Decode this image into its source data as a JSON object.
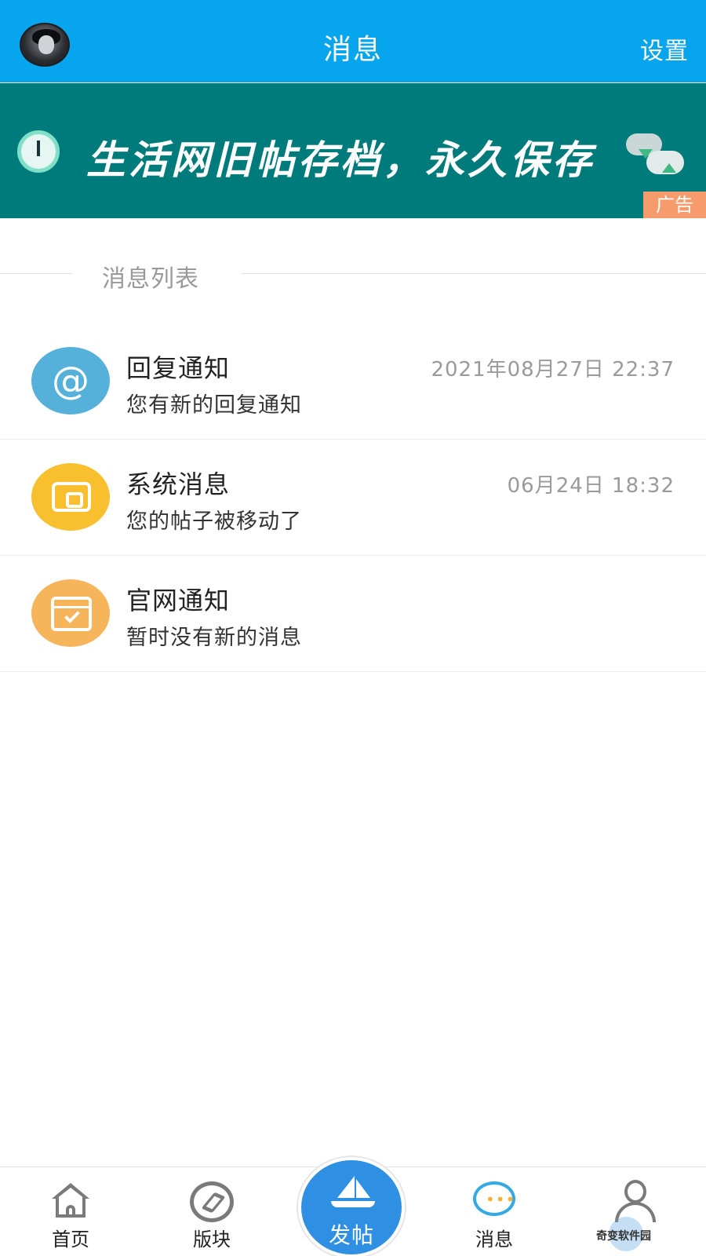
{
  "header": {
    "title": "消息",
    "settings_label": "设置"
  },
  "banner": {
    "text": "生活网旧帖存档，永久保存",
    "ad_label": "广告"
  },
  "section": {
    "label": "消息列表"
  },
  "messages": [
    {
      "title": "回复通知",
      "desc": "您有新的回复通知",
      "time": "2021年08月27日 22:37",
      "icon": "at-icon",
      "color": "#55b1d9"
    },
    {
      "title": "系统消息",
      "desc": "您的帖子被移动了",
      "time": "06月24日 18:32",
      "icon": "wallet-icon",
      "color": "#f8bf2f"
    },
    {
      "title": "官网通知",
      "desc": "暂时没有新的消息",
      "time": "",
      "icon": "calendar-check-icon",
      "color": "#f6b55b"
    }
  ],
  "tabbar": {
    "home": "首页",
    "boards": "版块",
    "post": "发帖",
    "messages": "消息",
    "watermark": "奇变软件园"
  },
  "colors": {
    "header_bg": "#06a5ed",
    "banner_bg": "#007b7c",
    "ad_tag": "#f59b6c",
    "post_button": "#2f8fe2",
    "active_tab_icon": "#33a9e6"
  }
}
